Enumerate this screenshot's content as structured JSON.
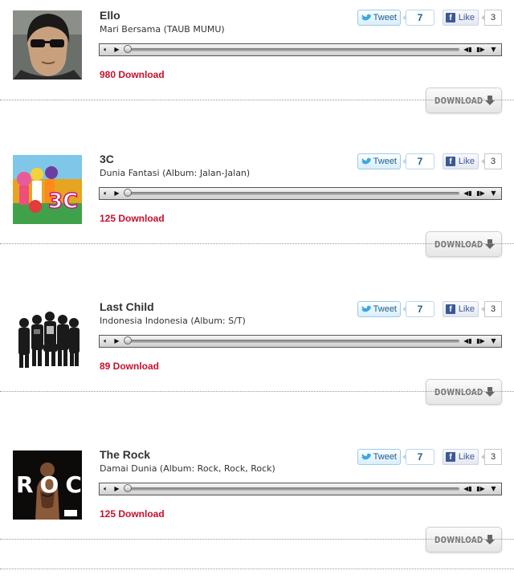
{
  "songs": [
    {
      "artist": "Ello",
      "title": "Mari Bersama (TAUB MUMU)",
      "downloads": "980 Download",
      "tweet_label": "Tweet",
      "tweet_count": "7",
      "like_label": "Like",
      "like_count": "3",
      "download_label": "DOWNLOAD"
    },
    {
      "artist": "3C",
      "title": "Dunia Fantasi (Album: Jalan-Jalan)",
      "downloads": "125 Download",
      "tweet_label": "Tweet",
      "tweet_count": "7",
      "like_label": "Like",
      "like_count": "3",
      "download_label": "DOWNLOAD",
      "cover_text": "3C"
    },
    {
      "artist": "Last Child",
      "title": "Indonesia Indonesia (Album: S/T)",
      "downloads": "89 Download",
      "tweet_label": "Tweet",
      "tweet_count": "7",
      "like_label": "Like",
      "like_count": "3",
      "download_label": "DOWNLOAD"
    },
    {
      "artist": "The Rock",
      "title": "Damai Dunia (Album: Rock, Rock, Rock)",
      "downloads": "125 Download",
      "tweet_label": "Tweet",
      "tweet_count": "7",
      "like_label": "Like",
      "like_count": "3",
      "download_label": "DOWNLOAD",
      "cover_text": "ROCK"
    }
  ],
  "icons": {
    "mute": "speaker-icon",
    "play": "play-icon",
    "prev": "previous-icon",
    "next": "next-icon",
    "menu": "dropdown-icon",
    "twitter": "twitter-bird-icon",
    "facebook": "facebook-icon",
    "download": "download-arrow-icon"
  },
  "colors": {
    "download_count": "#c8102e",
    "twitter": "#1d5e8a",
    "facebook": "#3b5998"
  }
}
